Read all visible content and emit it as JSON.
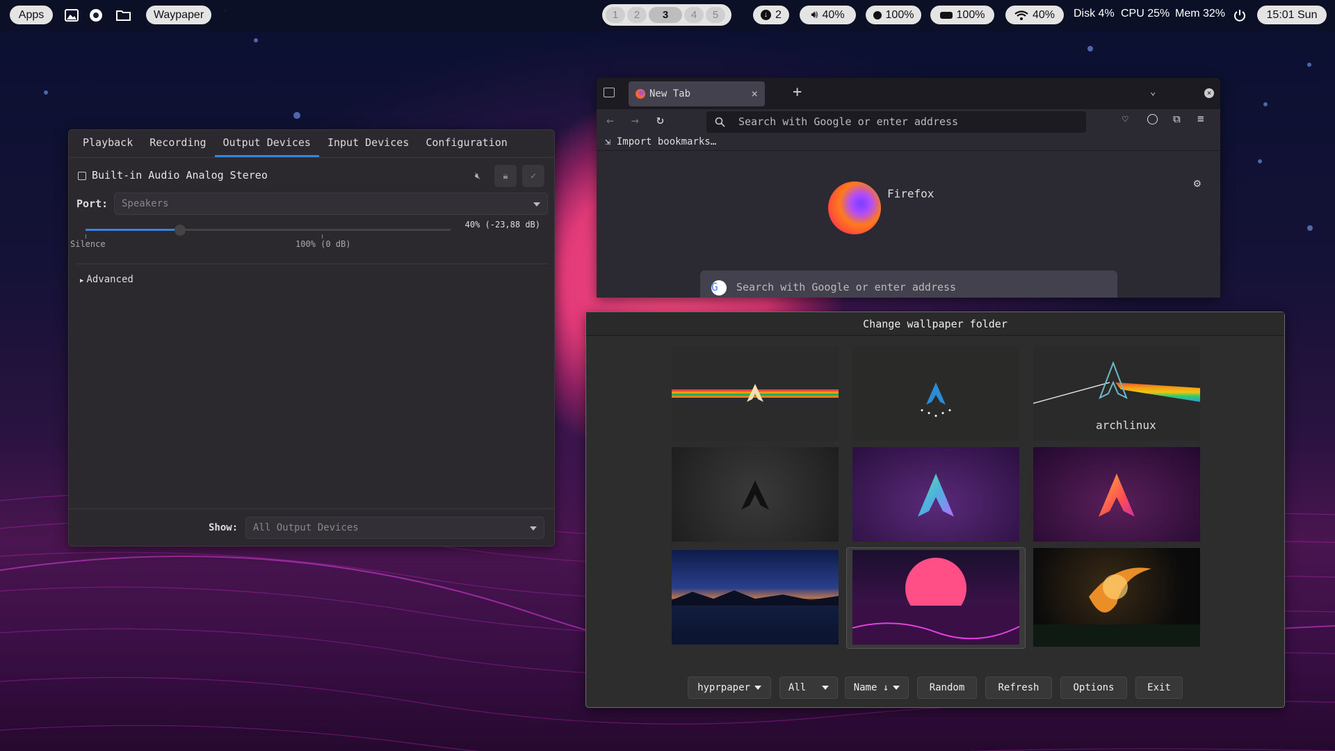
{
  "topbar": {
    "apps_label": "Apps",
    "app_name": "Waypaper",
    "workspaces": [
      "1",
      "2",
      "3",
      "4",
      "5"
    ],
    "active_workspace": "3",
    "updates": "2",
    "volume": "40%",
    "brightness": "100%",
    "battery": "100%",
    "wifi": "40%",
    "disk": "Disk 4%",
    "cpu": "CPU 25%",
    "mem": "Mem 32%",
    "clock": "15:01 Sun",
    "icons": [
      "image-icon",
      "screenshot-icon",
      "folder-icon",
      "download-icon",
      "speaker-icon",
      "brightness-icon",
      "battery-icon",
      "wifi-icon",
      "power-icon"
    ]
  },
  "pavucontrol": {
    "tabs": [
      "Playback",
      "Recording",
      "Output Devices",
      "Input Devices",
      "Configuration"
    ],
    "active_tab": "Output Devices",
    "device_name": "Built-in Audio Analog Stereo",
    "port_label": "Port:",
    "port_value": "Speakers",
    "volume_readout": "40% (-23,88 dB)",
    "volume_level": 0.4,
    "scale_min_label": "Silence",
    "scale_mid_label": "100% (0 dB)",
    "advanced_label": "Advanced",
    "show_label": "Show:",
    "show_value": "All Output Devices"
  },
  "firefox": {
    "tab_title": "New Tab",
    "address_placeholder": "Search with Google or enter address",
    "import_bookmarks": "Import bookmarks…",
    "brand": "Firefox",
    "search_placeholder": "Search with Google or enter address"
  },
  "waypaper": {
    "title": "Change wallpaper folder",
    "buttons": {
      "backend": "hyprpaper",
      "filter": "All",
      "sort": "Name ↓",
      "random": "Random",
      "refresh": "Refresh",
      "options": "Options",
      "exit": "Exit"
    },
    "thumbnail_texts": {
      "arch_logo_text": "archlinux"
    }
  },
  "colors": {
    "accent": "#3584e4",
    "pink_sun": "#ff4f86",
    "topbar_bg": "#0c1026"
  }
}
